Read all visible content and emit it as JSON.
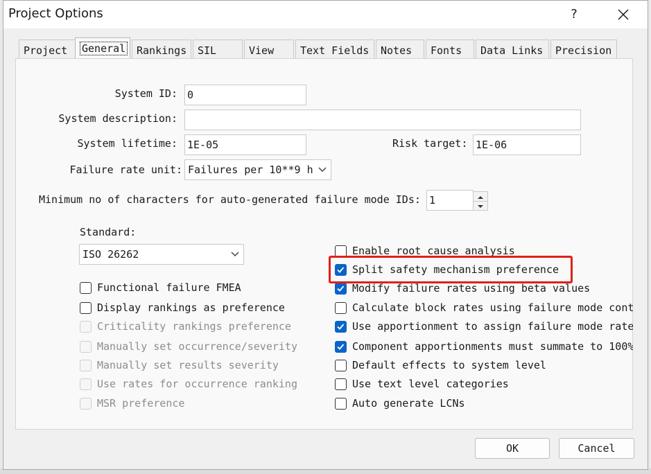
{
  "window": {
    "title": "Project Options",
    "help_label": "?"
  },
  "tabs": [
    {
      "label": "Project"
    },
    {
      "label": "General",
      "active": true
    },
    {
      "label": "Rankings"
    },
    {
      "label": "SIL"
    },
    {
      "label": "View"
    },
    {
      "label": "Text Fields"
    },
    {
      "label": "Notes"
    },
    {
      "label": "Fonts"
    },
    {
      "label": "Data Links"
    },
    {
      "label": "Precision"
    }
  ],
  "fields": {
    "system_id": {
      "label": "System ID:",
      "value": "0"
    },
    "system_description": {
      "label": "System description:",
      "value": ""
    },
    "system_lifetime": {
      "label": "System lifetime:",
      "value": "1E-05"
    },
    "risk_target": {
      "label": "Risk target:",
      "value": "1E-06"
    },
    "failure_rate_unit": {
      "label": "Failure rate unit:",
      "value": "Failures per 10**9 h"
    },
    "min_chars": {
      "label": "Minimum no of characters for auto-generated failure mode IDs:",
      "value": "1"
    },
    "standard": {
      "label": "Standard:",
      "value": "ISO 26262"
    }
  },
  "left_checkboxes": [
    {
      "label": "Functional failure FMEA",
      "checked": false,
      "enabled": true
    },
    {
      "label": "Display rankings as preference",
      "checked": false,
      "enabled": true
    },
    {
      "label": "Criticality rankings preference",
      "checked": false,
      "enabled": false
    },
    {
      "label": "Manually set occurrence/severity",
      "checked": false,
      "enabled": false
    },
    {
      "label": "Manually set results severity",
      "checked": false,
      "enabled": false
    },
    {
      "label": "Use rates for occurrence ranking",
      "checked": false,
      "enabled": false
    },
    {
      "label": "MSR preference",
      "checked": false,
      "enabled": false
    }
  ],
  "right_checkboxes": [
    {
      "label": "Enable root cause analysis",
      "checked": false,
      "enabled": true
    },
    {
      "label": "Split safety mechanism preference",
      "checked": true,
      "enabled": true,
      "highlighted": true
    },
    {
      "label": "Modify failure rates using beta values",
      "checked": true,
      "enabled": true
    },
    {
      "label": "Calculate block rates using failure mode cont",
      "checked": false,
      "enabled": true
    },
    {
      "label": "Use apportionment to assign failure mode rate",
      "checked": true,
      "enabled": true
    },
    {
      "label": "Component apportionments must summate to 100%",
      "checked": true,
      "enabled": true
    },
    {
      "label": "Default effects to system level",
      "checked": false,
      "enabled": true
    },
    {
      "label": "Use text level categories",
      "checked": false,
      "enabled": true
    },
    {
      "label": "Auto generate LCNs",
      "checked": false,
      "enabled": true
    }
  ],
  "buttons": {
    "ok": "OK",
    "cancel": "Cancel"
  },
  "colors": {
    "highlight": "#e0201a",
    "checkbox_checked": "#0a64c8"
  },
  "icons": {
    "close": "close-icon",
    "chevron": "chevron-down-icon",
    "spin_up": "spin-up-icon",
    "spin_down": "spin-down-icon",
    "check": "checkmark-icon"
  }
}
